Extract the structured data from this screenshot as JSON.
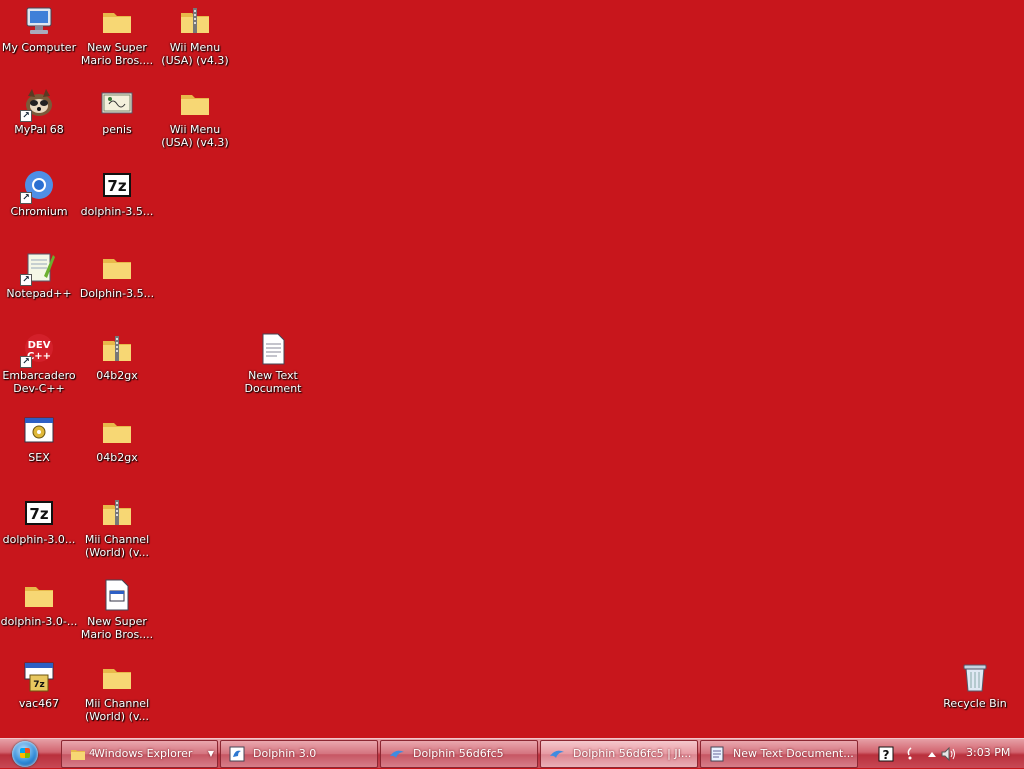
{
  "desktop": {
    "background_color": "#c8161c",
    "icons": [
      {
        "label": "My Computer",
        "icon": "my-computer-icon"
      },
      {
        "label": "MyPal 68",
        "icon": "mypal-icon"
      },
      {
        "label": "Chromium",
        "icon": "chromium-icon"
      },
      {
        "label": "Notepad++",
        "icon": "notepad-plus-plus-icon"
      },
      {
        "label": "Embarcadero Dev-C++",
        "icon": "dev-cpp-icon"
      },
      {
        "label": "SEX",
        "icon": "application-icon"
      },
      {
        "label": "dolphin-3.0...",
        "icon": "7z-archive-icon"
      },
      {
        "label": "dolphin-3.0-...",
        "icon": "folder-icon"
      },
      {
        "label": "vac467",
        "icon": "7z-installer-icon"
      },
      {
        "label": "New Super Mario Bros....",
        "icon": "folder-icon"
      },
      {
        "label": "penis",
        "icon": "certificate-icon"
      },
      {
        "label": "dolphin-3.5...",
        "icon": "7z-archive-icon"
      },
      {
        "label": "Dolphin-3.5...",
        "icon": "folder-icon"
      },
      {
        "label": "04b2gx",
        "icon": "zip-folder-icon"
      },
      {
        "label": "04b2gx",
        "icon": "folder-icon"
      },
      {
        "label": "Mii Channel (World) (v...",
        "icon": "zip-folder-icon"
      },
      {
        "label": "New Super Mario Bros....",
        "icon": "file-icon"
      },
      {
        "label": "Mii Channel (World) (v...",
        "icon": "folder-icon"
      },
      {
        "label": "Wii Menu (USA) (v4.3)",
        "icon": "zip-folder-icon"
      },
      {
        "label": "Wii Menu (USA) (v4.3)",
        "icon": "folder-icon"
      },
      {
        "label": "New Text Document",
        "icon": "text-document-icon"
      },
      {
        "label": "Recycle Bin",
        "icon": "recycle-bin-icon"
      }
    ]
  },
  "taskbar": {
    "start_icon": "windows-start-orb-icon",
    "tasks": [
      {
        "label": "Windows Explorer",
        "count": "4",
        "icon": "folder-icon"
      },
      {
        "label": "Dolphin 3.0",
        "icon": "dolphin-app-icon"
      },
      {
        "label": "Dolphin 56d6fc5",
        "icon": "dolphin-logo-icon"
      },
      {
        "label": "Dolphin 56d6fc5 | JI...",
        "icon": "dolphin-logo-icon"
      },
      {
        "label": "New Text Document...",
        "icon": "notepad-icon"
      }
    ],
    "tray": {
      "icons": [
        "help-icon",
        "network-icon",
        "show-hidden-icons-icon",
        "volume-icon"
      ],
      "time": "3:03 PM"
    }
  }
}
